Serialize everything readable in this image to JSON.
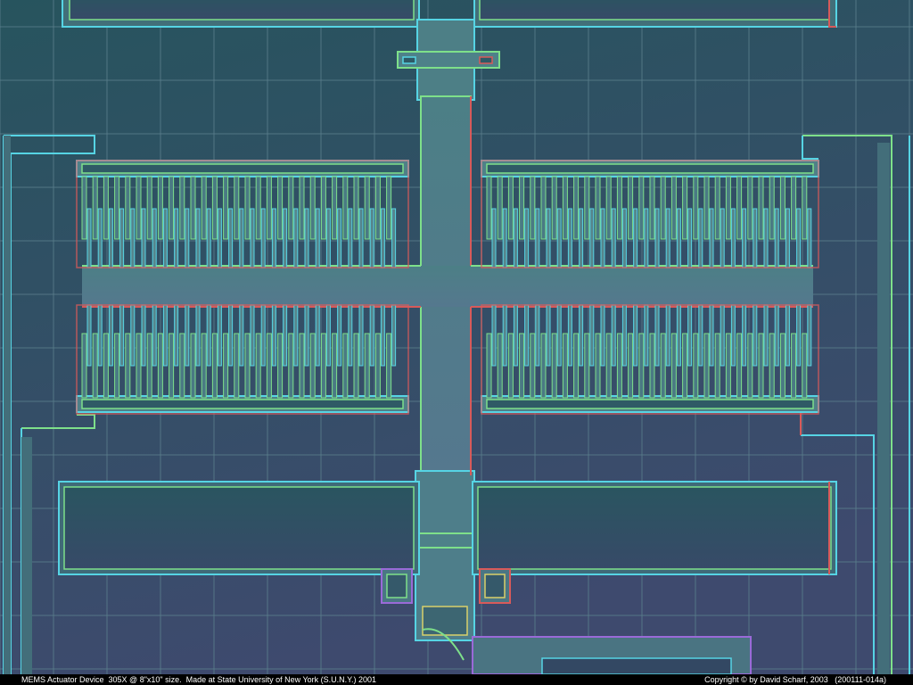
{
  "caption": {
    "left": "MEMS Actuator Device  305X @ 8\"x10\" size.  Made at State University of New York (S.U.N.Y.) 2001",
    "right": "Copyright © by David Scharf, 2003   (200111-014a)"
  },
  "colors": {
    "background_top": "#27545e",
    "background_bottom": "#3e4a6e",
    "grid": "#5b7f8c",
    "structure_fill": "#4f7e87",
    "edge_green": "#7ee08a",
    "edge_cyan": "#56d4e4",
    "edge_red": "#d85a5a",
    "edge_purple": "#9a6ad8",
    "caption_bar": "#000000",
    "caption_text": "#ffffff"
  }
}
